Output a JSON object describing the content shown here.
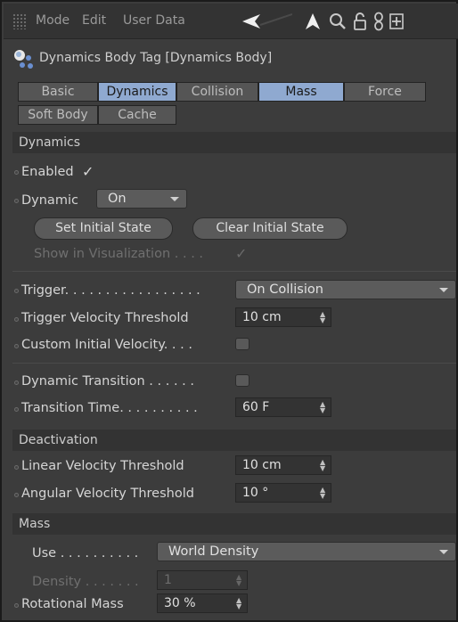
{
  "menubar": {
    "items": [
      "Mode",
      "Edit",
      "User Data"
    ],
    "icons": [
      "back-arrow-icon",
      "up-arrow-icon",
      "search-icon",
      "lock-icon",
      "link-icon",
      "new-panel-icon"
    ]
  },
  "title": {
    "icon": "dynamics-tag-icon",
    "text": "Dynamics Body Tag [Dynamics Body]"
  },
  "tabs": {
    "row1": [
      "Basic",
      "Dynamics",
      "Collision",
      "Mass",
      "Force"
    ],
    "row2": [
      "Soft Body",
      "Cache"
    ],
    "active": [
      "Dynamics",
      "Mass"
    ],
    "active_color": "#8fa9d0"
  },
  "dynamics": {
    "header": "Dynamics",
    "enabled_label": "Enabled",
    "dynamic_label": "Dynamic",
    "dynamic_value": "On",
    "set_initial_state": "Set Initial State",
    "clear_initial_state": "Clear Initial State",
    "show_in_visualization": "Show in Visualization . . . .",
    "trigger_label": "Trigger. . . . . . . . . . . . . . . . .",
    "trigger_value": "On Collision",
    "trigger_velocity_label": "Trigger Velocity Threshold",
    "trigger_velocity_value": "10 cm",
    "custom_initial_velocity_label": "Custom Initial Velocity. . . .",
    "dynamic_transition_label": "Dynamic Transition . . . . . .",
    "transition_time_label": "Transition Time. . . . . . . . . .",
    "transition_time_value": "60 F"
  },
  "deactivation": {
    "header": "Deactivation",
    "linear_label": "Linear Velocity Threshold",
    "linear_value": "10 cm",
    "angular_label": "Angular Velocity Threshold",
    "angular_value": "10 °"
  },
  "mass": {
    "header": "Mass",
    "use_label": "Use . . . . . . . . . .",
    "use_value": "World Density",
    "density_label": "Density . . . . . . .",
    "density_value": "1",
    "rotational_label": "Rotational Mass",
    "rotational_value": "30 %"
  }
}
